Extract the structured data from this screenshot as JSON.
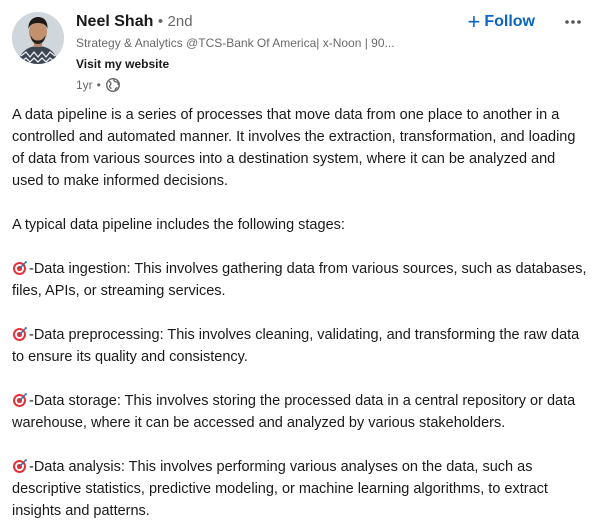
{
  "author": {
    "name": "Neel Shah",
    "separator": "•",
    "degree": "2nd",
    "headline": "Strategy & Analytics @TCS-Bank Of America| x-Noon | 90...",
    "website_link": "Visit my website",
    "age": "1yr",
    "meta_separator": "•"
  },
  "actions": {
    "follow_plus": "+",
    "follow_label": "Follow",
    "more_icon": "more-horizontal-icon"
  },
  "post": {
    "intro": "A data pipeline is a series of processes that move data from one place to another in a controlled and automated manner. It involves the extraction, transformation, and loading of data from various sources into a destination system, where it can be analyzed and used to make informed decisions.",
    "stages_intro": "A typical data pipeline includes the following stages:",
    "stages": [
      {
        "text": "-Data ingestion: This involves gathering data from various sources, such as databases, files, APIs, or streaming services."
      },
      {
        "text": "-Data preprocessing: This involves cleaning, validating, and transforming the raw data to ensure its quality and consistency."
      },
      {
        "text": "-Data storage: This involves storing the processed data in a central repository or data warehouse, where it can be accessed and analyzed by various stakeholders."
      },
      {
        "text": "-Data analysis: This involves performing various analyses on the data, such as descriptive statistics, predictive modeling, or machine learning algorithms, to extract insights and patterns."
      }
    ],
    "bullet_icon": "direct-hit-target-icon"
  },
  "colors": {
    "accent": "#0a66c2",
    "text_primary": "#191919",
    "text_secondary": "#666666"
  }
}
